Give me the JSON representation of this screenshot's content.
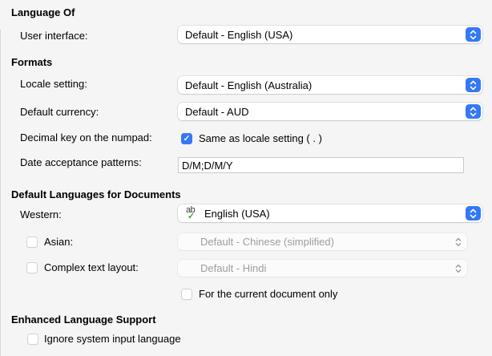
{
  "colors": {
    "accent_blue": "#3478f6",
    "background": "#f5f5f5",
    "disabled_text": "#9d9da1",
    "spellcheck_green": "#3fa53f"
  },
  "language_of": {
    "heading": "Language Of",
    "user_interface": {
      "label": "User interface:",
      "value": "Default - English (USA)"
    }
  },
  "formats": {
    "heading": "Formats",
    "locale_setting": {
      "label": "Locale setting:",
      "value": "Default - English (Australia)"
    },
    "default_currency": {
      "label": "Default currency:",
      "value": "Default - AUD"
    },
    "decimal_key": {
      "label": "Decimal key on the numpad:",
      "checkbox_label": "Same as locale setting ( . )",
      "checked": true
    },
    "date_patterns": {
      "label": "Date acceptance patterns:",
      "value": "D/M;D/M/Y"
    }
  },
  "default_languages": {
    "heading": "Default Languages for Documents",
    "western": {
      "label": "Western:",
      "value": "English (USA)",
      "icon": "abc-spellcheck-icon",
      "icon_ab": "ab",
      "icon_tick": "✓"
    },
    "asian": {
      "label": "Asian:",
      "value": "Default - Chinese (simplified)",
      "checked": false,
      "enabled": false
    },
    "complex_text_layout": {
      "label": "Complex text layout:",
      "value": "Default - Hindi",
      "checked": false,
      "enabled": false
    },
    "current_document_only": {
      "label": "For the current document only",
      "checked": false
    }
  },
  "enhanced": {
    "heading": "Enhanced Language Support",
    "ignore_system_input": {
      "label": "Ignore system input language",
      "checked": false
    }
  }
}
